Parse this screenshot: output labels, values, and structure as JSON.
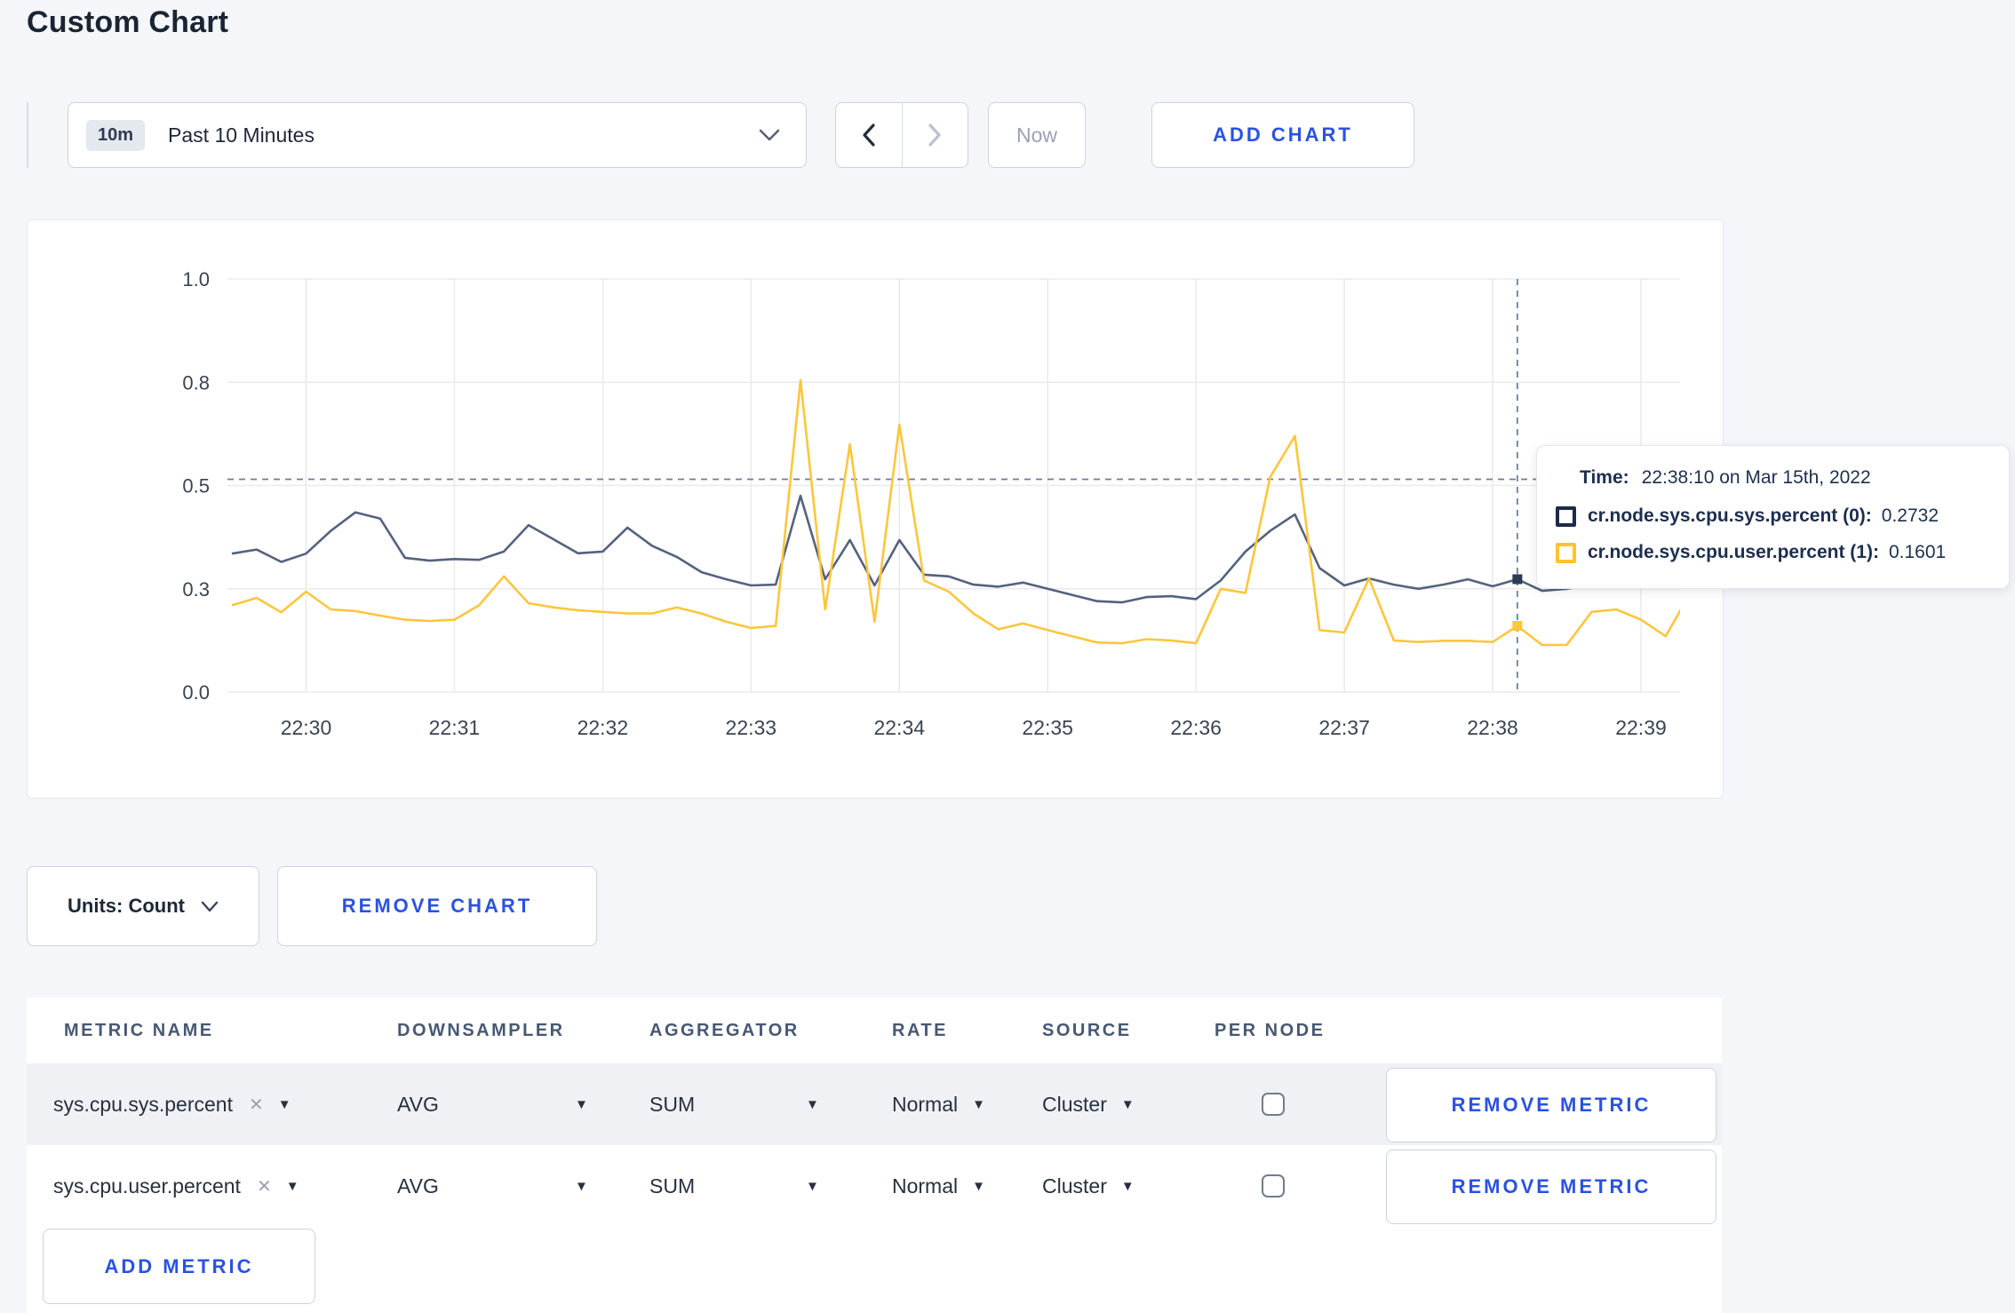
{
  "page": {
    "title": "Custom Chart"
  },
  "toolbar": {
    "time_range": {
      "badge": "10m",
      "label": "Past 10 Minutes"
    },
    "now_label": "Now",
    "add_chart_label": "ADD CHART"
  },
  "tooltip": {
    "time_label": "Time:",
    "time_value": "22:38:10 on Mar 15th, 2022",
    "rows": [
      {
        "name": "cr.node.sys.cpu.sys.percent (0):",
        "value": "0.2732",
        "color": "#1b2b49"
      },
      {
        "name": "cr.node.sys.cpu.user.percent (1):",
        "value": "0.1601",
        "color": "#ffc42e"
      }
    ]
  },
  "chart_controls": {
    "units_label": "Units: Count",
    "remove_chart_label": "REMOVE CHART"
  },
  "metrics_table": {
    "headers": [
      "METRIC NAME",
      "DOWNSAMPLER",
      "AGGREGATOR",
      "RATE",
      "SOURCE",
      "PER NODE"
    ],
    "rows": [
      {
        "metric": "sys.cpu.sys.percent",
        "downsampler": "AVG",
        "aggregator": "SUM",
        "rate": "Normal",
        "source": "Cluster",
        "per_node_checked": false,
        "remove_label": "REMOVE METRIC"
      },
      {
        "metric": "sys.cpu.user.percent",
        "downsampler": "AVG",
        "aggregator": "SUM",
        "rate": "Normal",
        "source": "Cluster",
        "per_node_checked": false,
        "remove_label": "REMOVE METRIC"
      }
    ],
    "add_metric_label": "ADD METRIC"
  },
  "chart_data": {
    "type": "line",
    "title": "",
    "xlabel": "",
    "ylabel": "",
    "ylim": [
      0,
      1
    ],
    "grid": true,
    "legend_position": "none",
    "start_time": "22:29:30",
    "interval_seconds": 10,
    "x_ticks": [
      {
        "label": "22:30",
        "s": 30
      },
      {
        "label": "22:31",
        "s": 90
      },
      {
        "label": "22:32",
        "s": 150
      },
      {
        "label": "22:33",
        "s": 210
      },
      {
        "label": "22:34",
        "s": 270
      },
      {
        "label": "22:35",
        "s": 330
      },
      {
        "label": "22:36",
        "s": 390
      },
      {
        "label": "22:37",
        "s": 450
      },
      {
        "label": "22:38",
        "s": 510
      },
      {
        "label": "22:39",
        "s": 570
      }
    ],
    "y_ticks": [
      {
        "label": "0.0",
        "v": 0
      },
      {
        "label": "0.3",
        "v": 0.25
      },
      {
        "label": "0.5",
        "v": 0.5
      },
      {
        "label": "0.8",
        "v": 0.75
      },
      {
        "label": "1.0",
        "v": 1.0
      }
    ],
    "guide_line_value": 0.515,
    "hover": {
      "s": 520,
      "time": "22:38:10"
    },
    "colors": {
      "gridline": "#e8eaef",
      "axis_text": "#3a4450",
      "crosshair": "#6e7f96"
    },
    "series": [
      {
        "name": "cr.node.sys.cpu.sys.percent",
        "color": "#54627e",
        "marker_color": "#2c3a52",
        "values": [
          0.335,
          0.345,
          0.315,
          0.335,
          0.39,
          0.435,
          0.42,
          0.325,
          0.318,
          0.322,
          0.32,
          0.34,
          0.404,
          0.37,
          0.336,
          0.34,
          0.398,
          0.354,
          0.327,
          0.29,
          0.273,
          0.258,
          0.26,
          0.475,
          0.273,
          0.368,
          0.258,
          0.368,
          0.284,
          0.28,
          0.26,
          0.255,
          0.265,
          0.25,
          0.235,
          0.22,
          0.217,
          0.23,
          0.232,
          0.225,
          0.27,
          0.34,
          0.39,
          0.43,
          0.3,
          0.258,
          0.275,
          0.26,
          0.25,
          0.26,
          0.273,
          0.256,
          0.2732,
          0.245,
          0.25,
          0.26,
          0.255,
          0.3,
          0.295,
          0.305
        ]
      },
      {
        "name": "cr.node.sys.cpu.user.percent",
        "color": "#fcc63d",
        "marker_color": "#fcc63d",
        "values": [
          0.21,
          0.228,
          0.193,
          0.243,
          0.2,
          0.196,
          0.185,
          0.175,
          0.172,
          0.175,
          0.21,
          0.28,
          0.215,
          0.205,
          0.198,
          0.194,
          0.19,
          0.19,
          0.205,
          0.19,
          0.17,
          0.155,
          0.16,
          0.755,
          0.2,
          0.6,
          0.17,
          0.647,
          0.27,
          0.243,
          0.19,
          0.152,
          0.166,
          0.15,
          0.135,
          0.12,
          0.118,
          0.128,
          0.125,
          0.118,
          0.25,
          0.24,
          0.52,
          0.62,
          0.15,
          0.144,
          0.275,
          0.125,
          0.121,
          0.124,
          0.124,
          0.121,
          0.1601,
          0.114,
          0.114,
          0.194,
          0.2,
          0.175,
          0.135,
          0.24
        ]
      }
    ]
  }
}
